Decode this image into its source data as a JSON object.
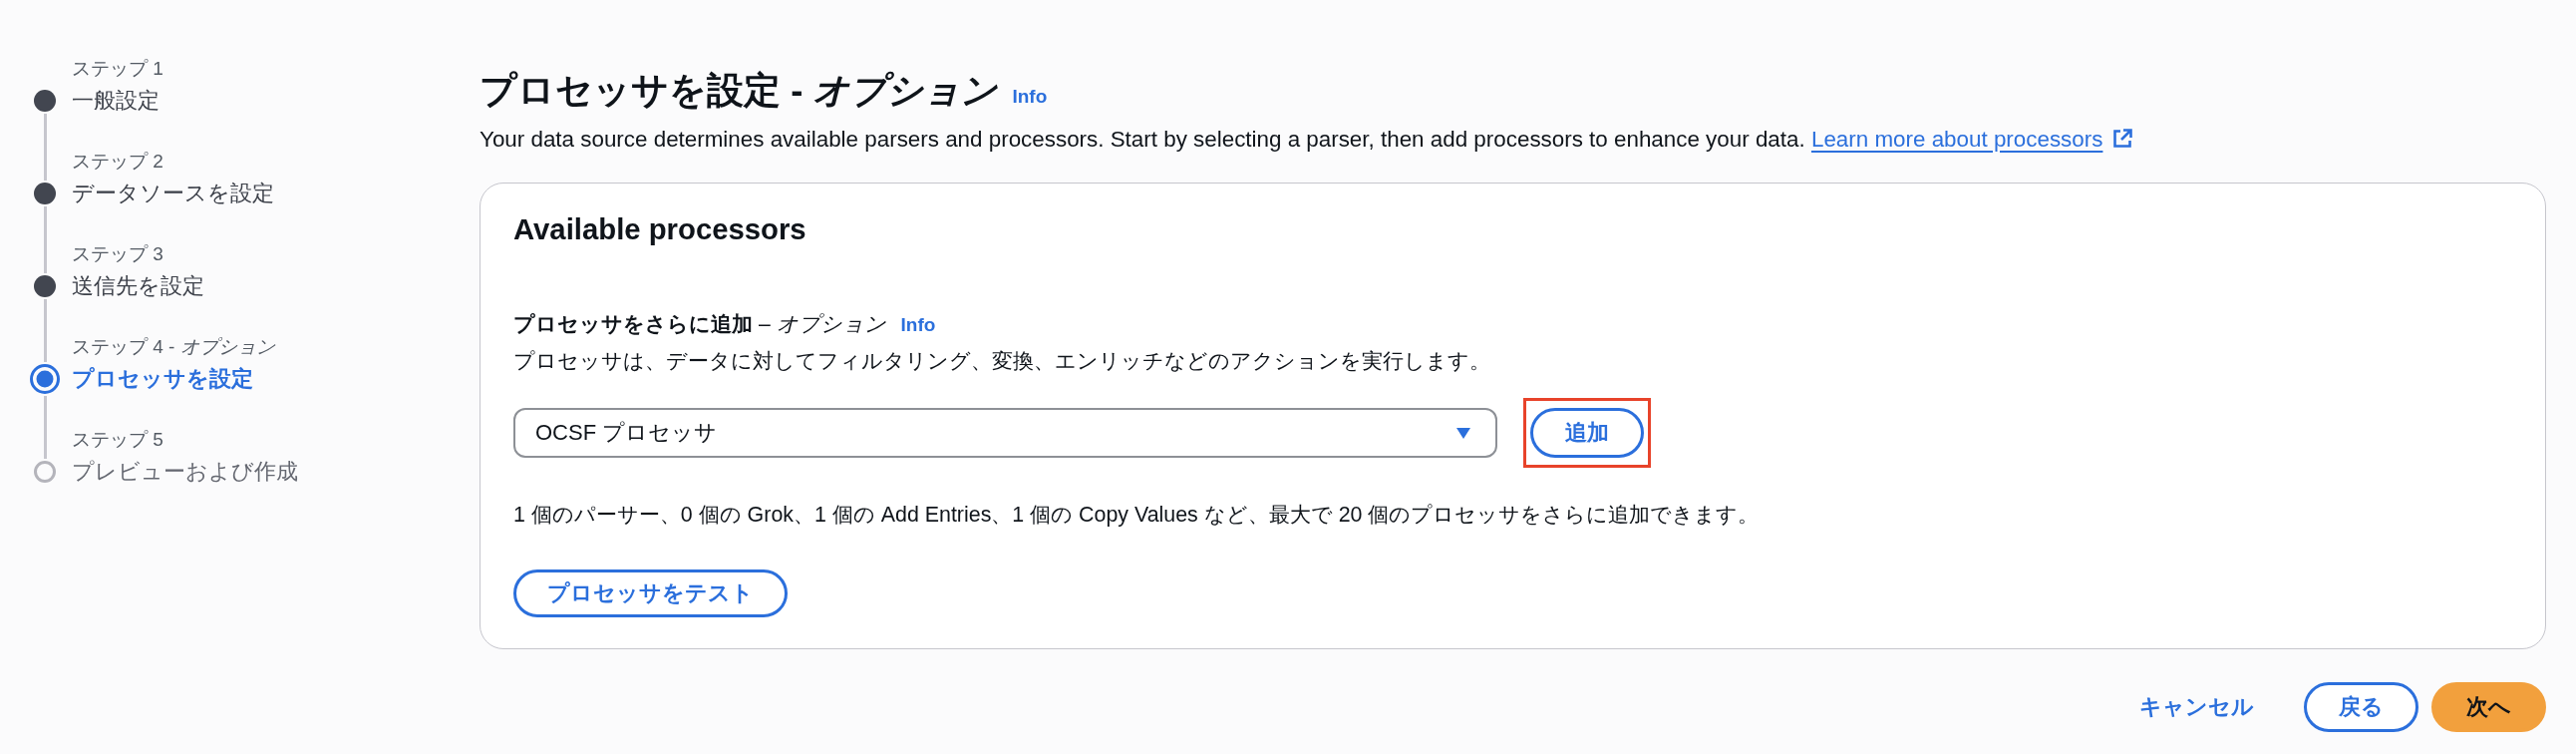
{
  "steps": [
    {
      "label": "ステップ 1",
      "title": "一般設定",
      "selected": false
    },
    {
      "label": "ステップ 2",
      "title": "データソースを設定",
      "selected": false
    },
    {
      "label": "ステップ 3",
      "title": "送信先を設定",
      "selected": false
    },
    {
      "label": "ステップ 4 - *オプション*",
      "title": "プロセッサを設定",
      "selected": true
    },
    {
      "label": "ステップ 5",
      "title": "プレビューおよび作成",
      "selected": false
    }
  ],
  "header": {
    "title": "プロセッサを設定 - *オプション*",
    "info": "Info",
    "description": "Your data source determines available parsers and processors. Start by selecting a parser, then add processors to enhance your data.",
    "learn_more_link": "Learn more about processors"
  },
  "panel": {
    "title": "Available processors",
    "field": {
      "label": "**プロセッサをさらに追加** – *オプション*",
      "info": "Info",
      "description": "プロセッサは、データに対してフィルタリング、変換、エンリッチなどのアクションを実行します。",
      "select": {
        "value": "OCSF プロセッサ"
      }
    },
    "add_button": {
      "label": "追加",
      "highlighted": true
    },
    "limit_text": "1 個のパーサー、0 個の Grok、1 個の Add Entries、1 個の Copy Values など、最大で 20 個のプロセッサをさらに追加できます。",
    "test_button": "プロセッサをテスト"
  },
  "footer": {
    "cancel": "キャンセル",
    "back": "戻る",
    "next": "次へ"
  }
}
